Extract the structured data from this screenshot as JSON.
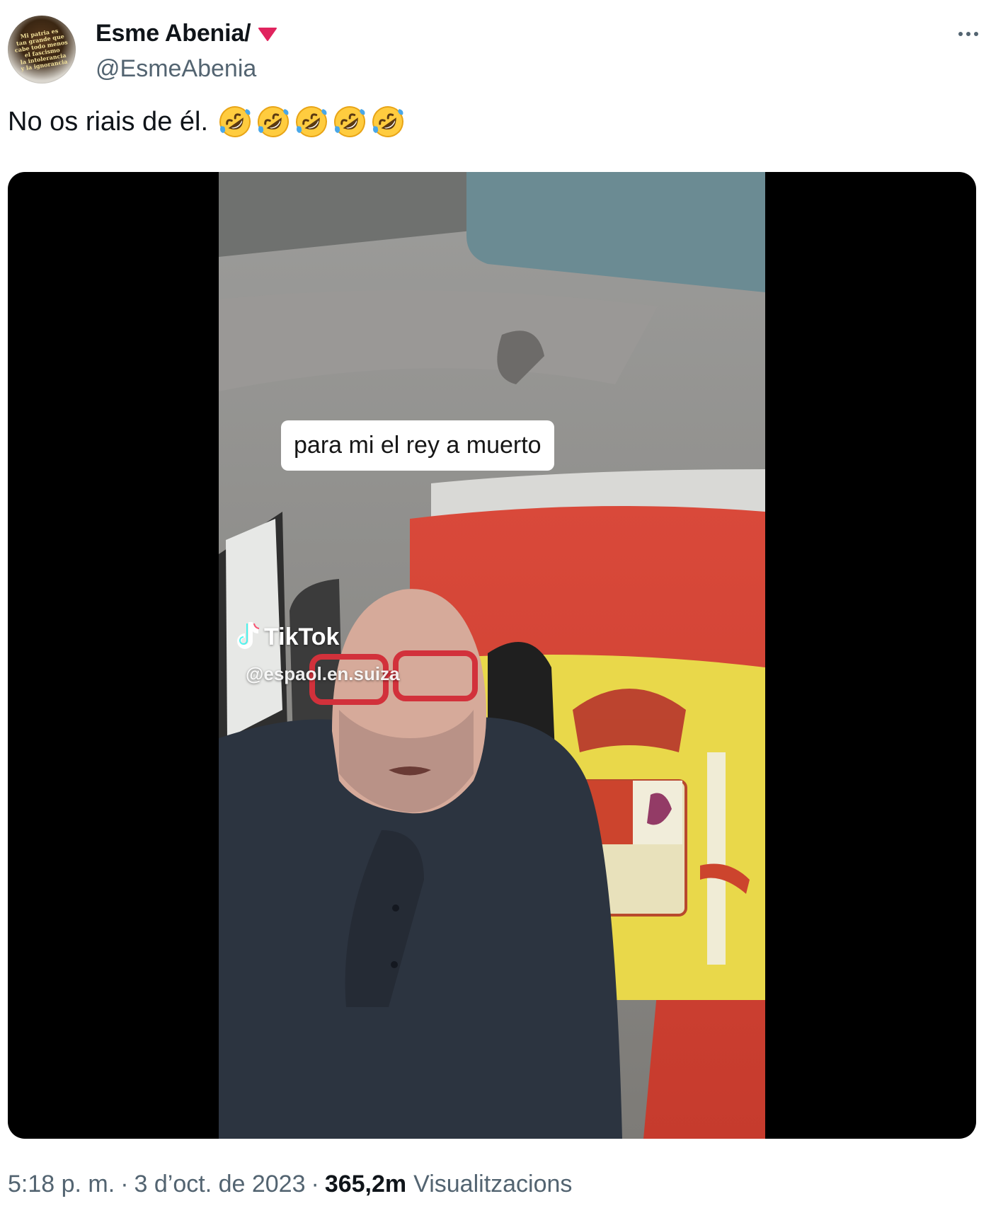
{
  "author": {
    "display_name": "Esme Abenia/",
    "handle": "@EsmeAbenia",
    "avatar_text": [
      "Mi patria es",
      "tan grande que",
      "cabe todo menos",
      "el fascismo",
      "la intolerancia",
      "y la ignorancia"
    ],
    "badge_icon": "red-down-triangle-icon",
    "badge_color": "#e0245e"
  },
  "tweet": {
    "text": "No os riais de él.",
    "emojis": [
      "🤣",
      "🤣",
      "🤣",
      "🤣",
      "🤣"
    ]
  },
  "media": {
    "caption": "para mi el rey a muerto",
    "watermark_brand": "TikTok",
    "watermark_handle": "@espaol.en.suiza"
  },
  "meta": {
    "time": "5:18 p. m.",
    "separator": "·",
    "date": "3 d’oct. de 2023",
    "views_count": "365,2m",
    "views_label": "Visualitzacions"
  },
  "icons": {
    "more": "more-horizontal-icon"
  }
}
